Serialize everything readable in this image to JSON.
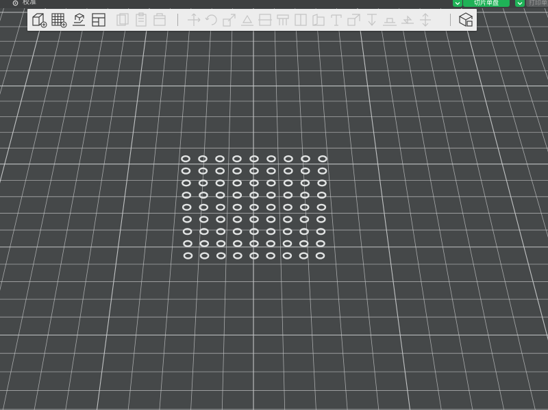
{
  "titlebar": {
    "tab_label": "校准",
    "slice_button_label": "切片单盘",
    "print_button_label": "打印单盘"
  },
  "icons": {
    "tab": "gear-icon",
    "dropdown": "chevron-down-icon"
  },
  "toolbar": {
    "active_tools": [
      "add-model-icon",
      "add-plate-icon",
      "auto-arrange-icon",
      "plate-layout-icon"
    ],
    "disabled_tools": [
      "copy-icon",
      "paste-icon",
      "delete-icon",
      "move-icon",
      "rotate-icon",
      "scale-icon",
      "lay-on-face-icon",
      "cut-icon",
      "support-paint-icon",
      "seam-paint-icon",
      "measure-icon",
      "text-icon",
      "assembly-icon",
      "split-icon",
      "brim-icon",
      "mirror-icon"
    ],
    "right_tool": "assembly-view-icon"
  },
  "scene": {
    "object": "calibration-ring-array",
    "rows": 9,
    "columns": 9
  },
  "colors": {
    "background": "#454849",
    "grid_line": "#c9cbcc",
    "toolbar_bg": "#ededed",
    "accent_green": "#1fb257",
    "ring": "#e2e4e4"
  }
}
